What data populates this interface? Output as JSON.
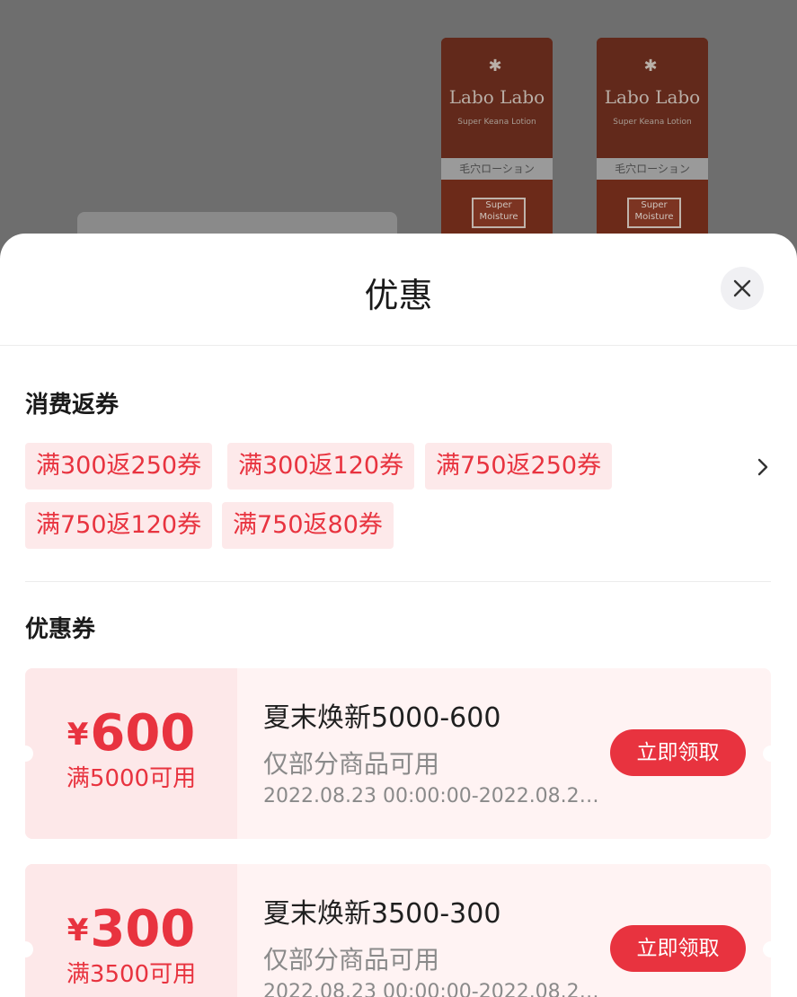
{
  "background": {
    "product_brand": "Labo Labo",
    "product_sub": "Super Keana Lotion",
    "product_label": "毛穴ローション",
    "product_badge": "Super Moisture"
  },
  "sheet": {
    "title": "优惠",
    "close_icon": "close-icon"
  },
  "cashback": {
    "title": "消费返券",
    "tags": [
      "满300返250券",
      "满300返120券",
      "满750返250券",
      "满750返120券",
      "满750返80券"
    ],
    "more_icon": "chevron-right-icon"
  },
  "coupons": {
    "title": "优惠券",
    "items": [
      {
        "currency": "¥",
        "amount": "600",
        "condition": "满5000可用",
        "name": "夏末焕新5000-600",
        "scope": "仅部分商品可用",
        "time": "2022.08.23 00:00:00-2022.08.2…",
        "claim": "立即领取"
      },
      {
        "currency": "¥",
        "amount": "300",
        "condition": "满3500可用",
        "name": "夏末焕新3500-300",
        "scope": "仅部分商品可用",
        "time": "2022.08.23 00:00:00-2022.08.2…",
        "claim": "立即领取"
      }
    ]
  },
  "colors": {
    "accent": "#e8333f",
    "tag_bg": "#fde9ea",
    "coupon_bg": "#fff3f3",
    "overlay": "#6b6b6b"
  }
}
